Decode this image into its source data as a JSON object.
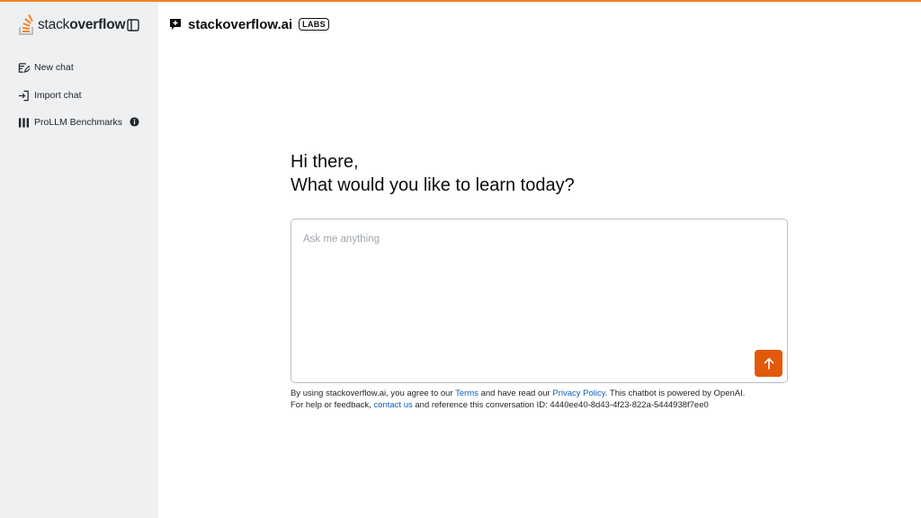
{
  "brand": {
    "logo_text_light": "stack",
    "logo_text_bold": "overflow",
    "accent_color": "#f48225",
    "button_color": "#e3590a",
    "link_color": "#0a5fb8"
  },
  "sidebar": {
    "toggle_icon": "sidebar-toggle-icon",
    "items": [
      {
        "label": "New chat",
        "icon": "new-chat-icon"
      },
      {
        "label": "Import chat",
        "icon": "import-icon"
      },
      {
        "label": "ProLLM Benchmarks",
        "icon": "bar-chart-icon"
      }
    ]
  },
  "header": {
    "title": "stackoverflow.ai",
    "badge": "LABS"
  },
  "main": {
    "greeting_line1": "Hi there,",
    "greeting_line2": "What would you like to learn today?",
    "input": {
      "value": "",
      "placeholder": "Ask me anything"
    },
    "send_icon": "arrow-up-icon"
  },
  "footer": {
    "line1_part1": "By using stackoverflow.ai, you agree to our ",
    "terms_link": "Terms",
    "line1_part2": " and have read our ",
    "privacy_link": "Privacy Policy",
    "line1_part3": ". This chatbot is powered by OpenAI.",
    "line2_part1": "For help or feedback, ",
    "contact_link": "contact us",
    "line2_part2": " and reference this conversation ID: 4440ee40-8d43-4f23-822a-5444938f7ee0"
  }
}
